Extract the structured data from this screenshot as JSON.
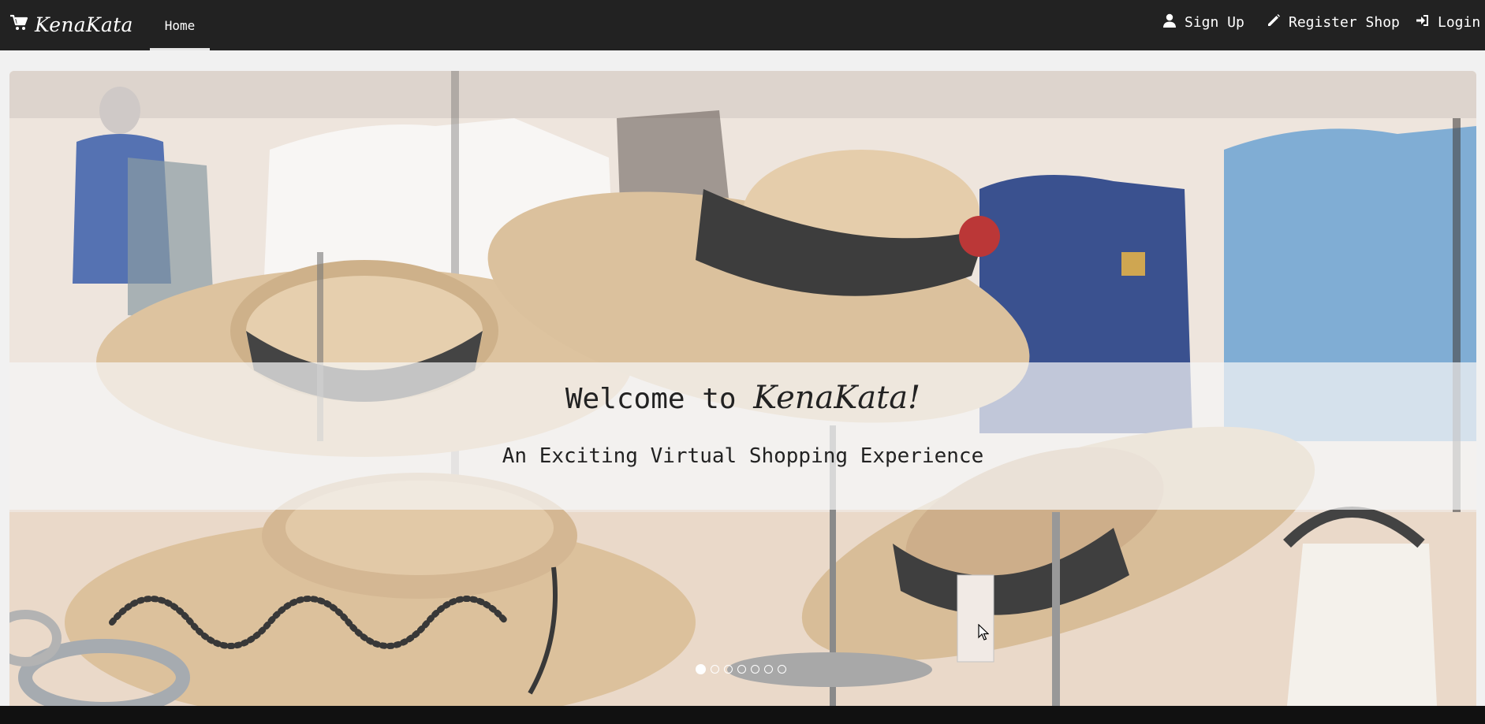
{
  "navbar": {
    "brand": "KenaKata",
    "home_label": "Home",
    "signup_label": "Sign Up",
    "register_label": "Register Shop",
    "login_label": "Login"
  },
  "hero": {
    "title_prefix": "Welcome to",
    "title_brand": "KenaKata!",
    "subtitle": "An Exciting Virtual Shopping Experience",
    "slide_count": 7,
    "active_slide": 1
  },
  "colors": {
    "navbar_bg": "#222222",
    "page_bg": "#f1f1f1"
  },
  "icons": {
    "brand": "cart-icon",
    "signup": "user-icon",
    "register": "pencil-icon",
    "login": "login-icon"
  }
}
